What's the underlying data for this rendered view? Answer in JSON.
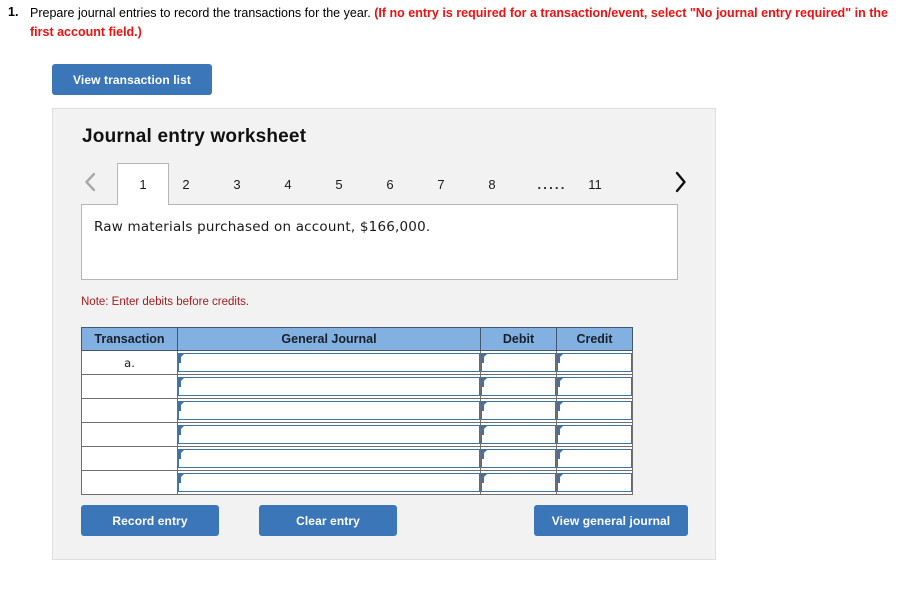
{
  "question": {
    "number": "1.",
    "plain_part": "Prepare journal entries to record the transactions for the year.",
    "bold_red_part": "(If no entry is required for a transaction/event, select \"No journal entry required\" in the first account field.)"
  },
  "toolbar": {
    "view_transaction_list_label": "View transaction list"
  },
  "worksheet": {
    "title": "Journal entry worksheet",
    "tabs": [
      {
        "label": "1",
        "active": true
      },
      {
        "label": "2",
        "active": false
      },
      {
        "label": "3",
        "active": false
      },
      {
        "label": "4",
        "active": false
      },
      {
        "label": "5",
        "active": false
      },
      {
        "label": "6",
        "active": false
      },
      {
        "label": "7",
        "active": false
      },
      {
        "label": "8",
        "active": false
      },
      {
        "label": ".....",
        "active": false
      },
      {
        "label": "11",
        "active": false
      }
    ],
    "prev_icon": "chevron-left-icon",
    "next_icon": "chevron-right-icon",
    "description": "Raw materials purchased on account, $166,000.",
    "note": "Note: Enter debits before credits."
  },
  "table": {
    "headers": [
      "Transaction",
      "General Journal",
      "Debit",
      "Credit"
    ],
    "rows": [
      {
        "transaction": "a.",
        "general_journal": "",
        "debit": "",
        "credit": ""
      },
      {
        "transaction": "",
        "general_journal": "",
        "debit": "",
        "credit": ""
      },
      {
        "transaction": "",
        "general_journal": "",
        "debit": "",
        "credit": ""
      },
      {
        "transaction": "",
        "general_journal": "",
        "debit": "",
        "credit": ""
      },
      {
        "transaction": "",
        "general_journal": "",
        "debit": "",
        "credit": ""
      },
      {
        "transaction": "",
        "general_journal": "",
        "debit": "",
        "credit": ""
      }
    ]
  },
  "actions": {
    "record_entry_label": "Record entry",
    "clear_entry_label": "Clear entry",
    "view_general_journal_label": "View general journal"
  },
  "colors": {
    "button_blue": "#3a76b8",
    "table_header_blue": "#82b0e0",
    "field_border_blue": "#3f72a8",
    "panel_gray": "#f2f2f2",
    "alert_red": "#e81313",
    "note_red": "#a02020"
  }
}
